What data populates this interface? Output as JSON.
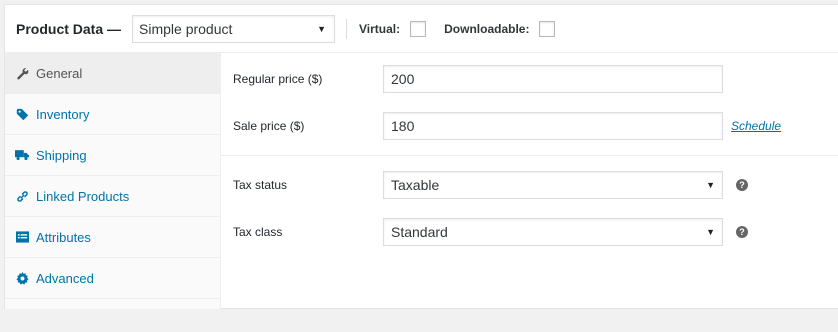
{
  "header": {
    "title": "Product Data —",
    "product_type": "Simple product",
    "virtual_label": "Virtual:",
    "downloadable_label": "Downloadable:"
  },
  "tabs": [
    {
      "label": "General",
      "icon": "wrench-icon",
      "active": true
    },
    {
      "label": "Inventory",
      "icon": "tag-icon"
    },
    {
      "label": "Shipping",
      "icon": "truck-icon"
    },
    {
      "label": "Linked Products",
      "icon": "link-icon"
    },
    {
      "label": "Attributes",
      "icon": "list-icon"
    },
    {
      "label": "Advanced",
      "icon": "gear-icon"
    }
  ],
  "fields": {
    "regular_price_label": "Regular price ($)",
    "regular_price_value": "200",
    "sale_price_label": "Sale price ($)",
    "sale_price_value": "180",
    "schedule_link": "Schedule",
    "tax_status_label": "Tax status",
    "tax_status_value": "Taxable",
    "tax_class_label": "Tax class",
    "tax_class_value": "Standard",
    "help_glyph": "?"
  },
  "colors": {
    "link": "#0073aa",
    "active_tab_bg": "#eeeeee"
  }
}
